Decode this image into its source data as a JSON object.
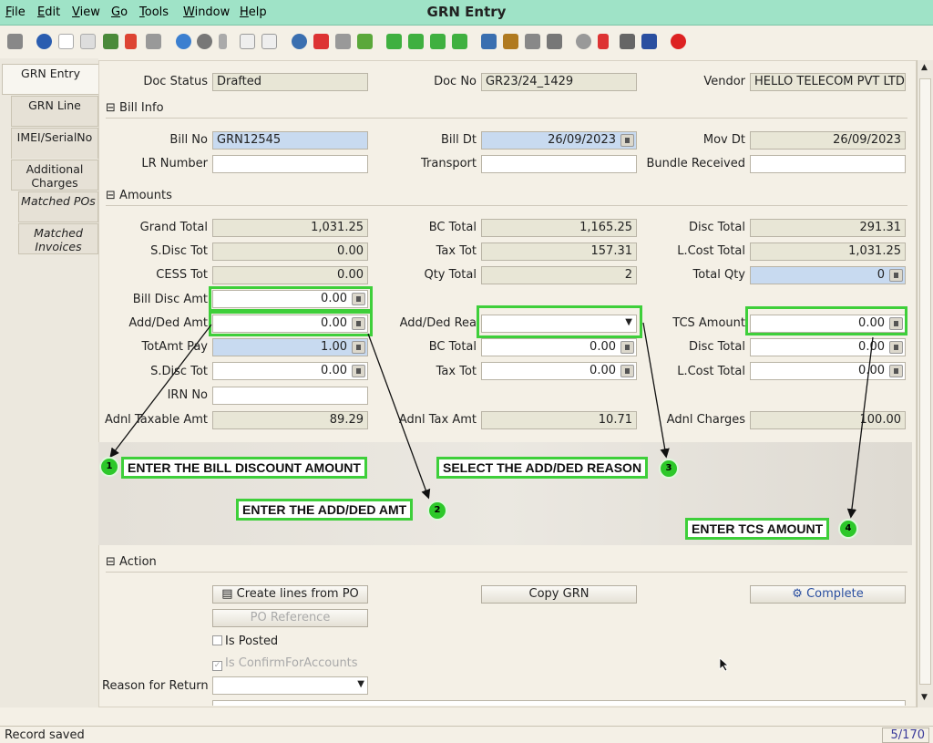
{
  "menu": {
    "file": "File",
    "edit": "Edit",
    "view": "View",
    "go": "Go",
    "tools": "Tools",
    "window": "Window",
    "help": "Help"
  },
  "window_title": "GRN Entry",
  "tabs": {
    "grn_entry": "GRN Entry",
    "grn_line": "GRN Line",
    "imei": "IMEI/SerialNo",
    "additional_charges": "Additional Charges",
    "matched_pos": "Matched POs",
    "matched_invoices": "Matched Invoices"
  },
  "header": {
    "doc_status_label": "Doc Status",
    "doc_status": "Drafted",
    "doc_no_label": "Doc No",
    "doc_no": "GR23/24_1429",
    "vendor_label": "Vendor",
    "vendor": "HELLO TELECOM PVT LTD"
  },
  "bill_info": {
    "section": "Bill Info",
    "bill_no_label": "Bill No",
    "bill_no": "GRN12545",
    "bill_dt_label": "Bill Dt",
    "bill_dt": "26/09/2023",
    "mov_dt_label": "Mov Dt",
    "mov_dt": "26/09/2023",
    "lr_label": "LR Number",
    "lr": "",
    "transport_label": "Transport",
    "transport": "",
    "bundle_label": "Bundle Received",
    "bundle": ""
  },
  "amounts": {
    "section": "Amounts",
    "grand_total_label": "Grand Total",
    "grand_total": "1,031.25",
    "bc_total_label": "BC Total",
    "bc_total": "1,165.25",
    "disc_total_label": "Disc Total",
    "disc_total": "291.31",
    "sdisc_label": "S.Disc Tot",
    "sdisc": "0.00",
    "tax_tot_label": "Tax Tot",
    "tax_tot": "157.31",
    "lcost_label": "L.Cost Total",
    "lcost": "1,031.25",
    "cess_label": "CESS Tot",
    "cess": "0.00",
    "qty_total_label": "Qty Total",
    "qty_total": "2",
    "total_qty_label": "Total Qty",
    "total_qty": "0",
    "bill_disc_label": "Bill Disc Amt",
    "bill_disc": "0.00",
    "add_ded_label": "Add/Ded Amt",
    "add_ded": "0.00",
    "add_ded_rea_label": "Add/Ded Rea",
    "add_ded_rea": "",
    "tcs_label": "TCS Amount",
    "tcs": "0.00",
    "totamt_label": "TotAmt Pay",
    "totamt": "1.00",
    "bc_total2_label": "BC Total",
    "bc_total2": "0.00",
    "disc_total2_label": "Disc Total",
    "disc_total2": "0.00",
    "sdisc2_label": "S.Disc Tot",
    "sdisc2": "0.00",
    "tax_tot2_label": "Tax Tot",
    "tax_tot2": "0.00",
    "lcost2_label": "L.Cost Total",
    "lcost2": "0.00",
    "irn_label": "IRN No",
    "irn": "",
    "adnl_taxable_label": "Adnl Taxable Amt",
    "adnl_taxable": "89.29",
    "adnl_tax_label": "Adnl Tax Amt",
    "adnl_tax": "10.71",
    "adnl_charges_label": "Adnl Charges",
    "adnl_charges": "100.00"
  },
  "annotations": {
    "a1": "ENTER THE BILL DISCOUNT AMOUNT",
    "n1": "1",
    "a2": "ENTER THE ADD/DED AMT",
    "n2": "2",
    "a3": "SELECT THE ADD/DED REASON",
    "n3": "3",
    "a4": "ENTER TCS AMOUNT",
    "n4": "4"
  },
  "action": {
    "section": "Action",
    "create_lines": "Create lines from PO",
    "copy_grn": "Copy GRN",
    "complete": "Complete",
    "po_reference": "PO Reference",
    "is_posted": "Is Posted",
    "is_confirm": "Is ConfirmForAccounts",
    "reason_label": "Reason for Return",
    "reason": ""
  },
  "status": {
    "text": "Record saved",
    "count": "5/170"
  },
  "colors": {
    "menubar": "#9fe3c7",
    "highlight": "#3ecf3a",
    "blue_field": "#c8daf0"
  }
}
